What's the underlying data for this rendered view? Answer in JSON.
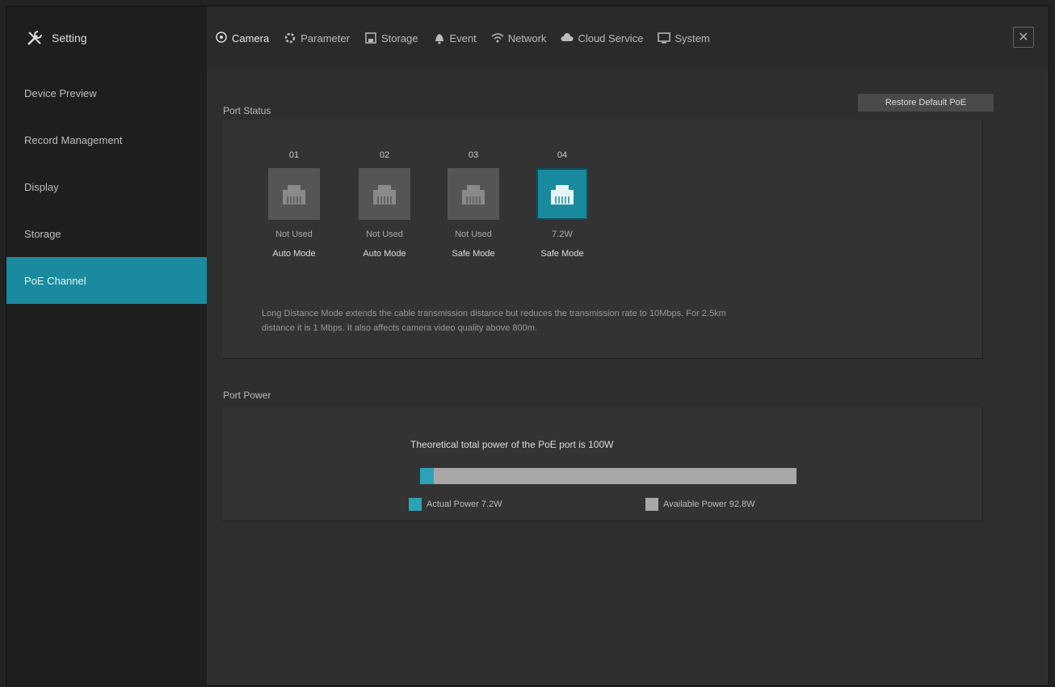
{
  "brand": {
    "title": "Setting"
  },
  "nav": [
    {
      "label": "Camera",
      "icon": "camera-icon"
    },
    {
      "label": "Parameter",
      "icon": "gear-icon"
    },
    {
      "label": "Storage",
      "icon": "disk-icon"
    },
    {
      "label": "Event",
      "icon": "bell-icon"
    },
    {
      "label": "Network",
      "icon": "wifi-icon"
    },
    {
      "label": "Cloud Service",
      "icon": "cloud-icon"
    },
    {
      "label": "System",
      "icon": "monitor-icon"
    }
  ],
  "sidebar": {
    "items": [
      {
        "label": "Device Preview"
      },
      {
        "label": "Record Management"
      },
      {
        "label": "Display"
      },
      {
        "label": "Storage"
      },
      {
        "label": "PoE Channel"
      }
    ],
    "active_index": 4
  },
  "port_status": {
    "title": "Port Status",
    "reset_label": "Restore Default PoE",
    "ports": [
      {
        "num": "01",
        "status": "Not Used",
        "mode": "Auto Mode",
        "active": false
      },
      {
        "num": "02",
        "status": "Not Used",
        "mode": "Auto Mode",
        "active": false
      },
      {
        "num": "03",
        "status": "Not Used",
        "mode": "Safe Mode",
        "active": false
      },
      {
        "num": "04",
        "status": "7.2W",
        "mode": "Safe Mode",
        "active": true
      }
    ],
    "note_line1": "Long Distance Mode extends the cable transmission distance but reduces the transmission rate to 10Mbps. For 2.5km",
    "note_line2": "distance it is 1 Mbps. It also affects camera video quality above 800m."
  },
  "port_power": {
    "title": "Port Power",
    "budget_text": "Theoretical total power of the PoE port is 100W",
    "actual_label": "Actual Power 7.2W",
    "available_label": "Available Power 92.8W",
    "actual_fraction": 0.036,
    "actual_color": "#2aa2b8",
    "available_color": "#a8a8a8"
  }
}
